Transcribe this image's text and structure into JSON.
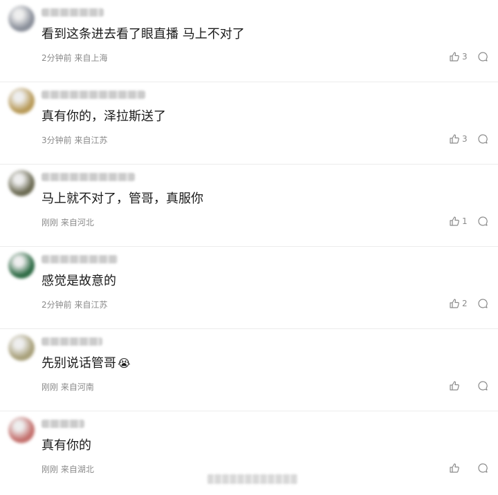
{
  "comments": [
    {
      "text": "看到这条进去看了眼直播 马上不对了",
      "time": "2分钟前",
      "location": "来自上海",
      "likes": "3",
      "emoji": "",
      "avatar_color": "#8a8f9a"
    },
    {
      "text": "真有你的，泽拉斯送了",
      "time": "3分钟前",
      "location": "来自江苏",
      "likes": "3",
      "emoji": "",
      "avatar_color": "#b89a58"
    },
    {
      "text": "马上就不对了，管哥，真服你",
      "time": "刚刚",
      "location": "来自河北",
      "likes": "1",
      "emoji": "",
      "avatar_color": "#6b6a52"
    },
    {
      "text": "感觉是故意的",
      "time": "2分钟前",
      "location": "来自江苏",
      "likes": "2",
      "emoji": "",
      "avatar_color": "#2e6b45"
    },
    {
      "text": "先别说话管哥",
      "time": "刚刚",
      "location": "来自河南",
      "likes": "",
      "emoji": "😭",
      "avatar_color": "#a8a07a"
    },
    {
      "text": "真有你的",
      "time": "刚刚",
      "location": "来自湖北",
      "likes": "",
      "emoji": "",
      "avatar_color": "#c4706d"
    }
  ]
}
